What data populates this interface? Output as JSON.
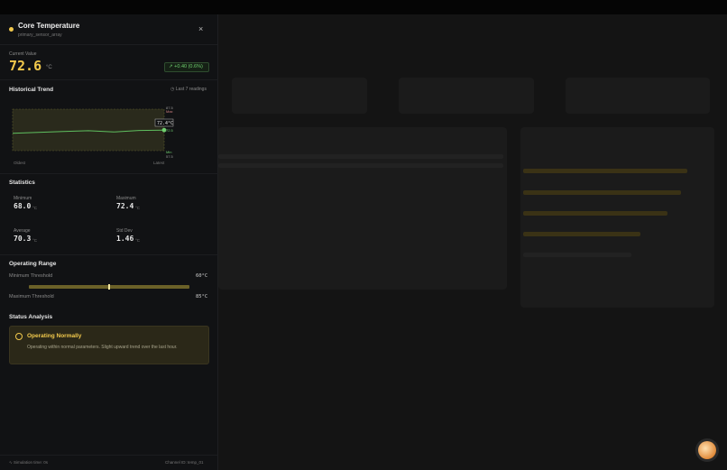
{
  "panel": {
    "title": "Core Temperature",
    "subtitle": "primary_sensor_array",
    "close_glyph": "×"
  },
  "current": {
    "label": "Current Value",
    "value": "72.6",
    "unit": "°C",
    "delta": "+0.40 (0.6%)",
    "delta_glyph": "↗"
  },
  "trend": {
    "title": "Historical Trend",
    "readings_label": "Last 7 readings",
    "clock_glyph": "◷",
    "x_start": "Oldest",
    "x_end": "Latest",
    "max_value": "87.5",
    "max_label": "Max",
    "min_value": "57.5",
    "min_label": "Min",
    "callout": "72.4°C",
    "current_tick": "72.5"
  },
  "chart_data": {
    "type": "line",
    "x": [
      1,
      2,
      3,
      4,
      5,
      6,
      7
    ],
    "values": [
      70.0,
      70.7,
      71.3,
      71.9,
      71.0,
      72.1,
      72.4
    ],
    "ylim": [
      57.5,
      87.5
    ],
    "xlabel": "",
    "ylabel": "",
    "grid": false
  },
  "statistics": {
    "title": "Statistics",
    "min_label": "Minimum",
    "min_value": "68.0",
    "max_label": "Maximum",
    "max_value": "72.4",
    "avg_label": "Average",
    "avg_value": "70.3",
    "std_label": "Std Dev",
    "std_value": "1.46",
    "unit": "°C"
  },
  "range": {
    "title": "Operating Range",
    "min_label": "Minimum Threshold",
    "min_value": "60°C",
    "max_label": "Maximum Threshold",
    "max_value": "85°C",
    "current_position": 0.5
  },
  "status": {
    "title": "Status Analysis",
    "state": "Operating Normally",
    "description": "Operating within normal parameters. Slight upward trend over the last hour."
  },
  "footer": {
    "simulation": "Simulation time: 0s",
    "simulation_glyph": "∿",
    "channel": "Channel ID: temp_01"
  },
  "colors": {
    "accent": "#f2c94c",
    "line": "#6fcf6f",
    "background": "#111214"
  }
}
